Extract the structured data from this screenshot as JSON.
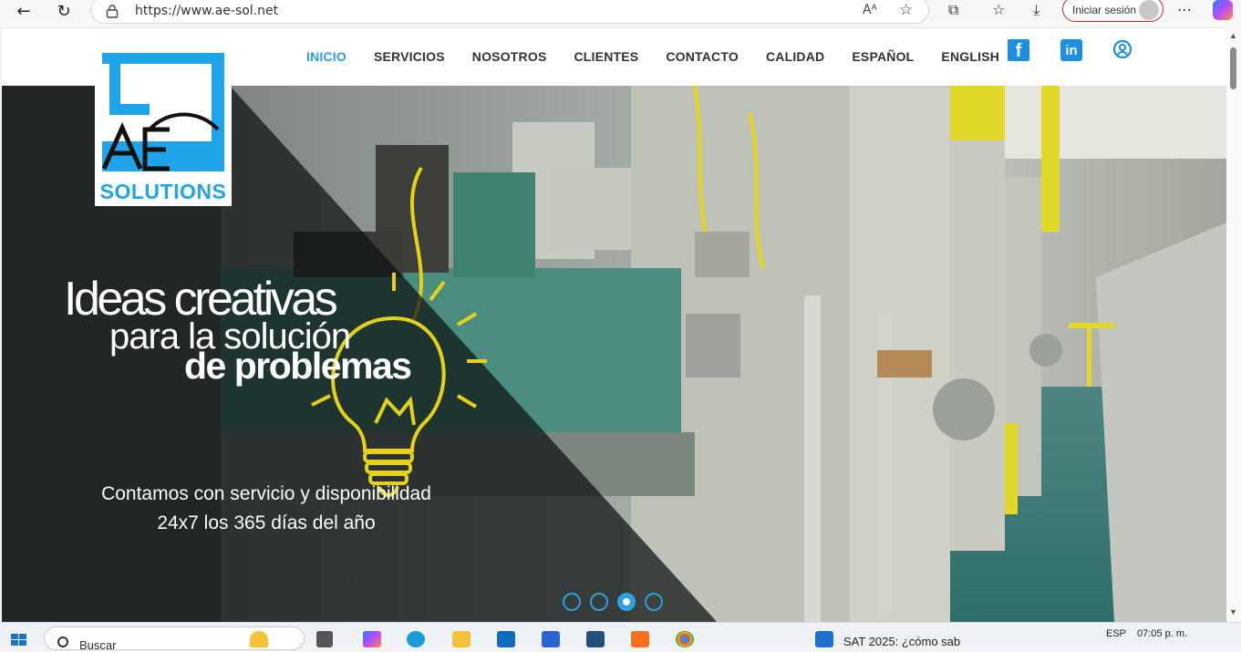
{
  "browser": {
    "url": "https://www.ae-sol.net",
    "signin_label": "Iniciar sesión"
  },
  "site": {
    "logo_text": "SOLUTIONS",
    "logo_mark": "AE",
    "menu": [
      {
        "label": "INICIO",
        "active": true
      },
      {
        "label": "SERVICIOS",
        "active": false
      },
      {
        "label": "NOSOTROS",
        "active": false
      },
      {
        "label": "CLIENTES",
        "active": false
      },
      {
        "label": "CONTACTO",
        "active": false
      },
      {
        "label": "CALIDAD",
        "active": false
      },
      {
        "label": "ESPAÑOL",
        "active": false
      },
      {
        "label": "ENGLISH",
        "active": false
      }
    ],
    "social": {
      "facebook": "f",
      "linkedin": "in"
    },
    "hero": {
      "line1": "Ideas creativas",
      "line2": "para la solución",
      "line3": "de problemas",
      "sub1": "Contamos con servicio y disponibilidad",
      "sub2": "24x7 los 365 días del año",
      "slides": 4,
      "active_slide": 3
    },
    "colors": {
      "accent": "#2a9fe0",
      "bulb": "#e4d21a"
    }
  },
  "taskbar": {
    "search_placeholder": "Buscar",
    "news": "SAT 2025: ¿cómo sab",
    "lang": "ESP",
    "time": "07:05 p. m."
  }
}
